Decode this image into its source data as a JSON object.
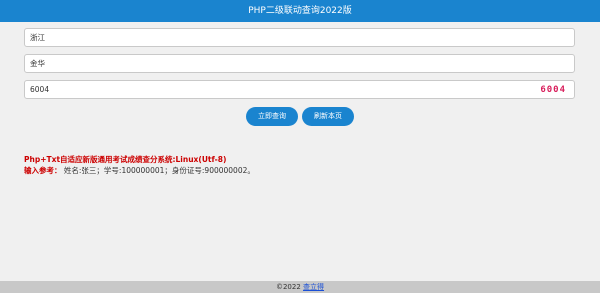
{
  "header": {
    "title": "PHP二级联动查询2022版"
  },
  "form": {
    "field1_value": "浙江",
    "field2_value": "金华",
    "field3_value": "6004",
    "captcha_text": "6004"
  },
  "buttons": {
    "query_label": "立即查询",
    "refresh_label": "刷新本页"
  },
  "notes": {
    "title": "Php+Txt自适应新版通用考试成绩查分系统:Linux(Utf-8)",
    "example_label": "输入参考：",
    "example_text": "姓名:张三；学号:100000001；身份证号:900000002。"
  },
  "footer": {
    "copyright": "©2022",
    "link_text": "查立得"
  },
  "colors": {
    "accent": "#1a84cf",
    "note_red": "#cc0000",
    "captcha": "#d81e5b"
  }
}
